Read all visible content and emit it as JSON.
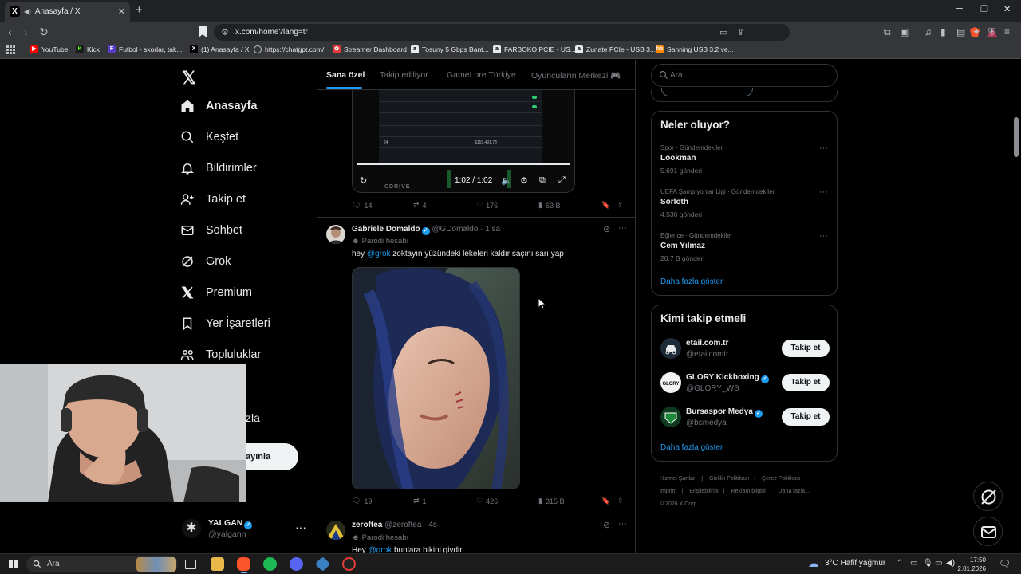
{
  "browser": {
    "tab_title": "Anasayfa / X",
    "url": "x.com/home?lang=tr",
    "bookmarks": [
      {
        "label": "YouTube",
        "color": "#ff0000",
        "icon": "youtube-icon"
      },
      {
        "label": "Kick",
        "color": "#53fc18",
        "icon": "kick-icon"
      },
      {
        "label": "Futbol - skorlar, tak...",
        "color": "#5b3cc4",
        "icon": "futbol-icon"
      },
      {
        "label": "(1) Anasayfa / X",
        "color": "#000000",
        "icon": "x-icon"
      },
      {
        "label": "https://chatgpt.com/",
        "color": "#74aa9c",
        "icon": "chatgpt-icon"
      },
      {
        "label": "Streamer Dashboard",
        "color": "#ff4d4d",
        "icon": "streamer-icon"
      },
      {
        "label": "Tosuny 5 Gbps Bant...",
        "color": "#cccccc",
        "icon": "amazon-icon"
      },
      {
        "label": "FARBOKO PCIE - US...",
        "color": "#cccccc",
        "icon": "amazon-icon"
      },
      {
        "label": "Zunate PCIe - USB 3...",
        "color": "#cccccc",
        "icon": "amazon-icon"
      },
      {
        "label": "Sanning USB 3.2 ve...",
        "color": "#ff8800",
        "icon": "hb-icon"
      }
    ]
  },
  "nav": {
    "items": [
      {
        "label": "Anasayfa",
        "icon": "home-icon",
        "active": true
      },
      {
        "label": "Keşfet",
        "icon": "search-icon"
      },
      {
        "label": "Bildirimler",
        "icon": "bell-icon"
      },
      {
        "label": "Takip et",
        "icon": "follow-icon"
      },
      {
        "label": "Sohbet",
        "icon": "mail-icon"
      },
      {
        "label": "Grok",
        "icon": "grok-icon"
      },
      {
        "label": "Premium",
        "icon": "x-icon"
      },
      {
        "label": "Yer İşaretleri",
        "icon": "bookmark-icon"
      },
      {
        "label": "Topluluklar",
        "icon": "communities-icon"
      }
    ],
    "more_partial": "zla",
    "post_button_partial": "ayınla",
    "account": {
      "name": "YALGAN",
      "handle": "@yalgann"
    }
  },
  "timeline": {
    "tabs": [
      "Sana özel",
      "Takip ediliyor",
      "GameLore Türkiye",
      "Oyuncuların Merkezi 🎮"
    ],
    "video": {
      "time": "1:02 / 1:02",
      "overlay_number_left": "24",
      "overlay_number_right": "$159,491.78",
      "logo": "CDRIVE"
    },
    "first_post_actions": {
      "replies": "14",
      "reposts": "4",
      "likes": "176",
      "views": "63 B"
    },
    "post": {
      "name": "Gabriele Domaldo",
      "handle": "@GDomaldo",
      "time": "· 1 sa",
      "parody": "Parodi hesabı",
      "mention": "@grok",
      "text": "zoktayın yüzündeki lekeleri kaldır saçını sarı yap",
      "actions": {
        "replies": "19",
        "reposts": "1",
        "likes": "426",
        "views": "315 B"
      }
    },
    "next_post": {
      "name": "zeroftea",
      "handle": "@zeroftea",
      "time": "· 4s",
      "parody": "Parodi hesabı",
      "text_prefix": "Hey",
      "mention": "@grok",
      "text": "bunlara bikini giydir"
    }
  },
  "sidebar": {
    "search_placeholder": "Ara",
    "trends_title": "Neler oluyor?",
    "trends": [
      {
        "category": "Spor · Gündemdekiler",
        "name": "Lookman",
        "count": "5.691 gönderi"
      },
      {
        "category": "UEFA Şampiyonlar Ligi · Gündemdekiler",
        "name": "Sörloth",
        "count": "4.530 gönderi"
      },
      {
        "category": "Eğlence · Gündemdekiler",
        "name": "Cem Yılmaz",
        "count": "20,7 B gönderi"
      }
    ],
    "show_more": "Daha fazla göster",
    "who_to_follow_title": "Kimi takip etmeli",
    "who_to_follow": [
      {
        "name": "etail.com.tr",
        "handle": "@etailcomtr",
        "verified": false
      },
      {
        "name": "GLORY Kickboxing",
        "handle": "@GLORY_WS",
        "verified": true
      },
      {
        "name": "Bursaspor Medya",
        "handle": "@bsmedya",
        "verified": true
      }
    ],
    "follow_label": "Takip et",
    "footer": [
      "Hizmet Şartları",
      "|",
      "Gizlilik Politikası",
      "|",
      "Çerez Politikası",
      "|",
      "Imprint",
      "|",
      "Erişilebilirlik",
      "|",
      "Reklam bilgisi",
      "|",
      "Daha fazla ...",
      "© 2026 X Corp."
    ]
  },
  "taskbar": {
    "search_placeholder": "Ara",
    "weather": "3°C  Hafif yağmur",
    "time": "17:50",
    "date": "2.01.2026"
  }
}
